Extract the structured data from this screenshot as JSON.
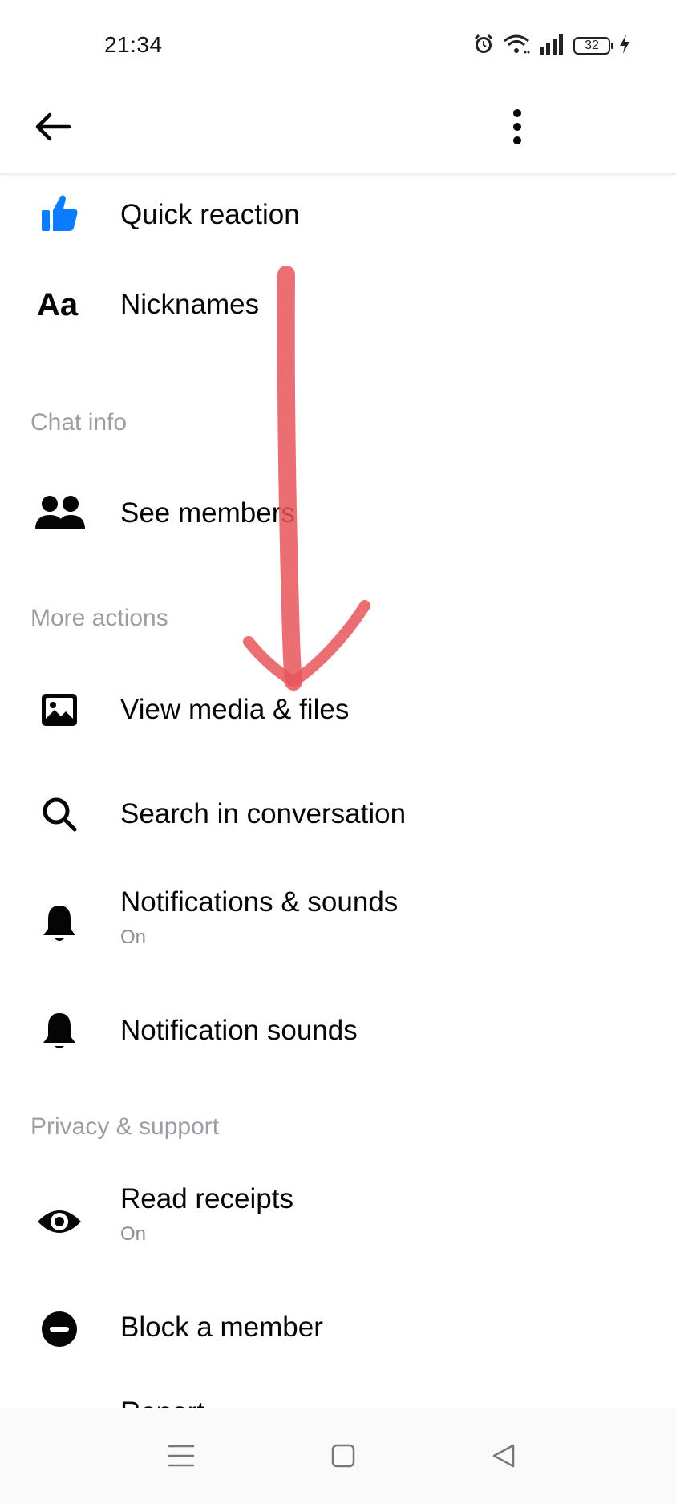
{
  "status_bar": {
    "time": "21:34",
    "battery_level": "32"
  },
  "sections": {
    "chat_info": "Chat info",
    "more_actions": "More actions",
    "privacy_support": "Privacy & support"
  },
  "items": {
    "quick_reaction": {
      "label": "Quick reaction"
    },
    "nicknames": {
      "label": "Nicknames",
      "icon_text": "Aa"
    },
    "see_members": {
      "label": "See members"
    },
    "view_media": {
      "label": "View media & files"
    },
    "search_conversation": {
      "label": "Search in conversation"
    },
    "notifications": {
      "label": "Notifications & sounds",
      "status": "On"
    },
    "notification_sounds": {
      "label": "Notification sounds"
    },
    "read_receipts": {
      "label": "Read receipts",
      "status": "On"
    },
    "block_member": {
      "label": "Block a member"
    },
    "report": {
      "label": "Report"
    }
  },
  "colors": {
    "accent": "#0a7cff",
    "annotation": "#e8555a",
    "section_text": "#9a9da2"
  }
}
